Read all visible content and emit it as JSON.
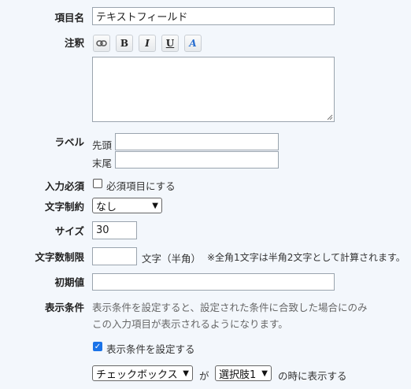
{
  "item_name": {
    "label": "項目名",
    "value": "テキストフィールド"
  },
  "note": {
    "label": "注釈",
    "toolbar": [
      {
        "name": "link-icon",
        "glyph": "🔗"
      },
      {
        "name": "bold-icon",
        "glyph": "B"
      },
      {
        "name": "italic-icon",
        "glyph": "I"
      },
      {
        "name": "underline-icon",
        "glyph": "U"
      },
      {
        "name": "font-color-icon",
        "glyph": "A"
      }
    ],
    "value": ""
  },
  "label_field": {
    "label": "ラベル",
    "prefix_label": "先頭",
    "suffix_label": "末尾",
    "prefix_value": "",
    "suffix_value": ""
  },
  "required": {
    "label": "入力必須",
    "checkbox_label": "必須項目にする",
    "checked": false
  },
  "char_limit": {
    "label": "文字制約",
    "selected": "なし"
  },
  "size": {
    "label": "サイズ",
    "value": "30"
  },
  "max_chars": {
    "label": "文字数制限",
    "value": "",
    "unit": "文字（半角）",
    "note": "※全角1文字は半角2文字として計算されます。"
  },
  "default_value": {
    "label": "初期値",
    "value": ""
  },
  "display_condition": {
    "label": "表示条件",
    "description_line1": "表示条件を設定すると、設定された条件に合致した場合にのみ",
    "description_line2": "この入力項目が表示されるようになります。",
    "checkbox_label": "表示条件を設定する",
    "checked": true,
    "field_select": "チェックボックス",
    "connector": "が",
    "option_select": "選択肢1",
    "suffix": "の時に表示する"
  }
}
